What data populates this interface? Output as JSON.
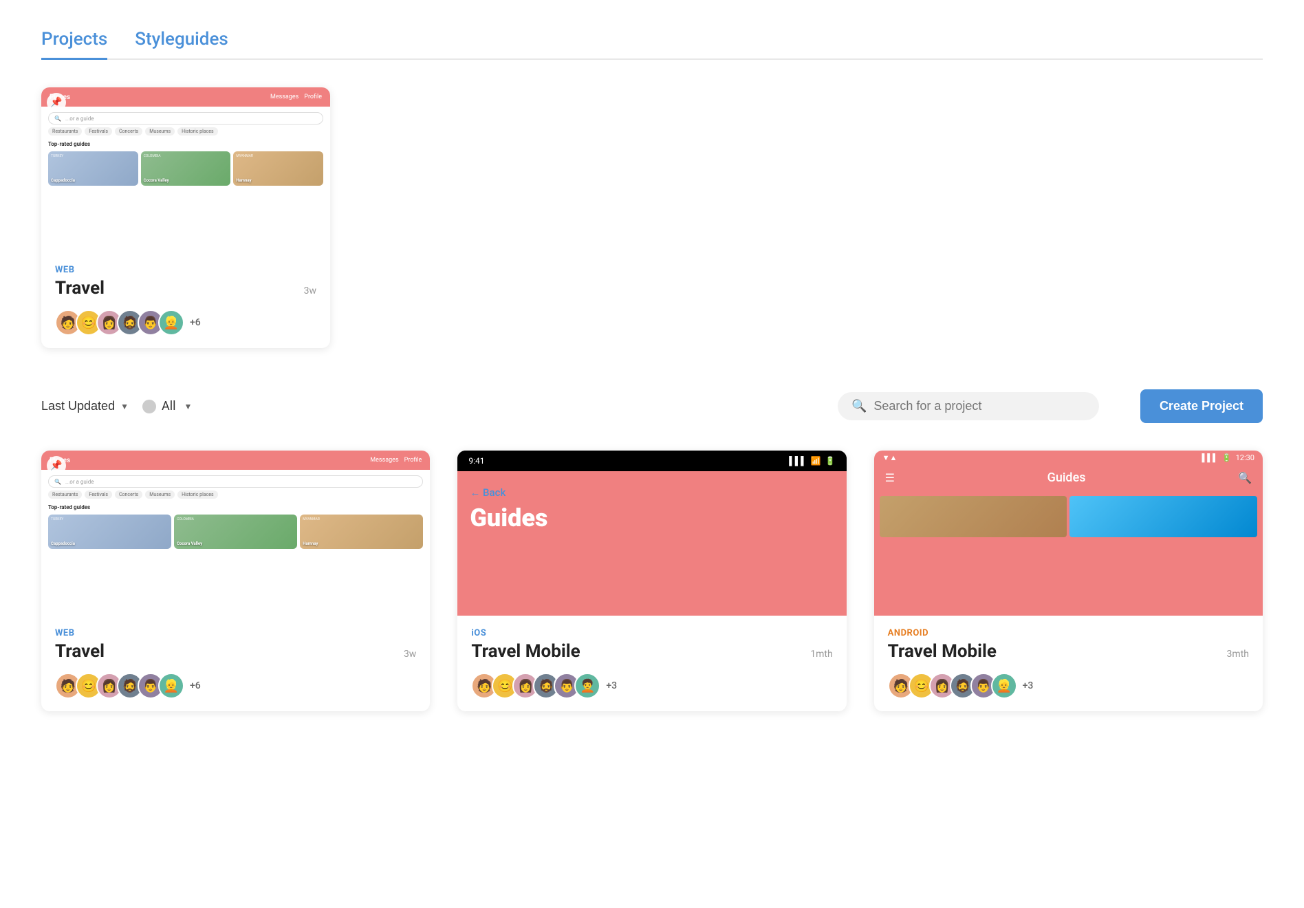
{
  "tabs": [
    {
      "id": "projects",
      "label": "Projects",
      "active": true
    },
    {
      "id": "styleguides",
      "label": "Styleguides",
      "active": false
    }
  ],
  "featured_card": {
    "type": "WEB",
    "title": "Travel",
    "time": "3w",
    "avatar_more": "+6",
    "preview": {
      "header_title": "Places",
      "nav_links": [
        "Messages",
        "Profile"
      ],
      "search_placeholder": "...or a guide",
      "tags": [
        "Restaurants",
        "Festivals",
        "Concerts",
        "Museums",
        "Historic places"
      ],
      "section_title": "Top-rated guides",
      "guides": [
        {
          "country": "TURKEY",
          "name": "Cappadoccia"
        },
        {
          "country": "COLOMBIA",
          "name": "Cocora Valley"
        },
        {
          "country": "MYANMAR",
          "name": "Hamnay"
        }
      ]
    }
  },
  "toolbar": {
    "filter_label": "Last Updated",
    "all_label": "All",
    "search_placeholder": "Search for a project",
    "create_label": "Create Project"
  },
  "projects": [
    {
      "type": "WEB",
      "title": "Travel",
      "time": "3w",
      "avatar_more": "+6",
      "platform": "web"
    },
    {
      "type": "iOS",
      "title": "Travel Mobile",
      "time": "1mth",
      "avatar_more": "+3",
      "platform": "ios"
    },
    {
      "type": "ANDROID",
      "title": "Travel Mobile",
      "time": "3mth",
      "avatar_more": "+3",
      "platform": "android"
    }
  ],
  "avatars": {
    "emojis": [
      "👤",
      "😊",
      "👩",
      "🧔",
      "👨",
      "👱"
    ]
  }
}
